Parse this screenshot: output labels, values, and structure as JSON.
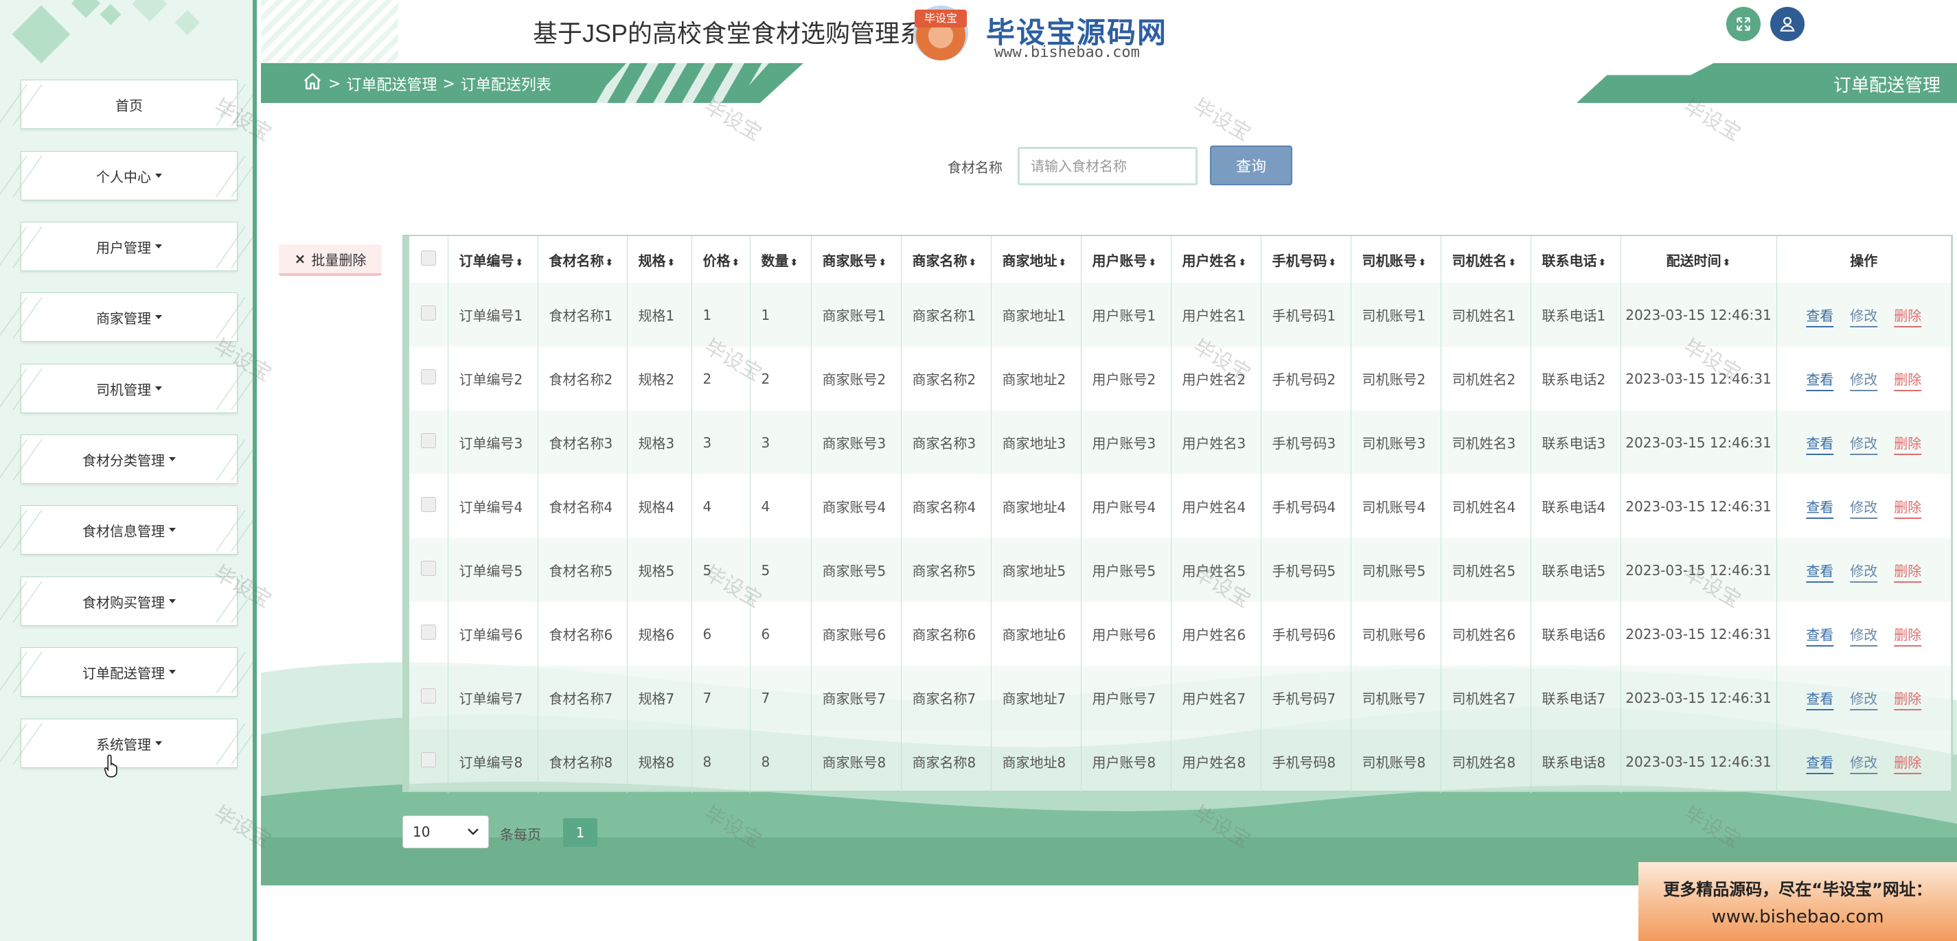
{
  "header": {
    "title": "基于JSP的高校食堂食材选购管理系统",
    "brand_badge": "毕设宝",
    "brand_name": "毕设宝源码网",
    "brand_url": "www.bishebao.com"
  },
  "breadcrumb": {
    "sep1": ">",
    "level1": "订单配送管理",
    "sep2": ">",
    "level2": "订单配送列表"
  },
  "page_title": "订单配送管理",
  "sidebar": {
    "items": [
      {
        "label": "首页"
      },
      {
        "label": "个人中心"
      },
      {
        "label": "用户管理"
      },
      {
        "label": "商家管理"
      },
      {
        "label": "司机管理"
      },
      {
        "label": "食材分类管理"
      },
      {
        "label": "食材信息管理"
      },
      {
        "label": "食材购买管理"
      },
      {
        "label": "订单配送管理"
      },
      {
        "label": "系统管理"
      }
    ]
  },
  "search": {
    "label": "食材名称",
    "placeholder": "请输入食材名称",
    "button": "查询"
  },
  "batch_delete": {
    "icon": "×",
    "label": "批量删除"
  },
  "table": {
    "headers": [
      "订单编号",
      "食材名称",
      "规格",
      "价格",
      "数量",
      "商家账号",
      "商家名称",
      "商家地址",
      "用户账号",
      "用户姓名",
      "手机号码",
      "司机账号",
      "司机姓名",
      "联系电话",
      "配送时间",
      "操作"
    ],
    "sort_icon": "⬍",
    "actions": {
      "view": "查看",
      "edit": "修改",
      "delete": "删除"
    },
    "rows": [
      [
        "订单编号1",
        "食材名称1",
        "规格1",
        "1",
        "1",
        "商家账号1",
        "商家名称1",
        "商家地址1",
        "用户账号1",
        "用户姓名1",
        "手机号码1",
        "司机账号1",
        "司机姓名1",
        "联系电话1",
        "2023-03-15 12:46:31"
      ],
      [
        "订单编号2",
        "食材名称2",
        "规格2",
        "2",
        "2",
        "商家账号2",
        "商家名称2",
        "商家地址2",
        "用户账号2",
        "用户姓名2",
        "手机号码2",
        "司机账号2",
        "司机姓名2",
        "联系电话2",
        "2023-03-15 12:46:31"
      ],
      [
        "订单编号3",
        "食材名称3",
        "规格3",
        "3",
        "3",
        "商家账号3",
        "商家名称3",
        "商家地址3",
        "用户账号3",
        "用户姓名3",
        "手机号码3",
        "司机账号3",
        "司机姓名3",
        "联系电话3",
        "2023-03-15 12:46:31"
      ],
      [
        "订单编号4",
        "食材名称4",
        "规格4",
        "4",
        "4",
        "商家账号4",
        "商家名称4",
        "商家地址4",
        "用户账号4",
        "用户姓名4",
        "手机号码4",
        "司机账号4",
        "司机姓名4",
        "联系电话4",
        "2023-03-15 12:46:31"
      ],
      [
        "订单编号5",
        "食材名称5",
        "规格5",
        "5",
        "5",
        "商家账号5",
        "商家名称5",
        "商家地址5",
        "用户账号5",
        "用户姓名5",
        "手机号码5",
        "司机账号5",
        "司机姓名5",
        "联系电话5",
        "2023-03-15 12:46:31"
      ],
      [
        "订单编号6",
        "食材名称6",
        "规格6",
        "6",
        "6",
        "商家账号6",
        "商家名称6",
        "商家地址6",
        "用户账号6",
        "用户姓名6",
        "手机号码6",
        "司机账号6",
        "司机姓名6",
        "联系电话6",
        "2023-03-15 12:46:31"
      ],
      [
        "订单编号7",
        "食材名称7",
        "规格7",
        "7",
        "7",
        "商家账号7",
        "商家名称7",
        "商家地址7",
        "用户账号7",
        "用户姓名7",
        "手机号码7",
        "司机账号7",
        "司机姓名7",
        "联系电话7",
        "2023-03-15 12:46:31"
      ],
      [
        "订单编号8",
        "食材名称8",
        "规格8",
        "8",
        "8",
        "商家账号8",
        "商家名称8",
        "商家地址8",
        "用户账号8",
        "用户姓名8",
        "手机号码8",
        "司机账号8",
        "司机姓名8",
        "联系电话8",
        "2023-03-15 12:46:31"
      ]
    ]
  },
  "pagination": {
    "page_size": "10",
    "page_size_label": "条每页",
    "current_page": "1"
  },
  "promo": {
    "line1": "更多精品源码，尽在“毕设宝”网址：",
    "line2": "www.bishebao.com"
  },
  "watermark_text": "毕设宝",
  "colors": {
    "primary": "#5aa886",
    "sidebar_bg": "#e9f6ef",
    "view_link": "#3b6ea8",
    "edit_link": "#6a88a8",
    "delete_link": "#e06d6d",
    "search_button": "#7a9cc0"
  },
  "icons": {
    "home": "home-icon",
    "fullscreen": "fullscreen-icon",
    "user": "user-icon",
    "close": "close-icon",
    "caret": "caret-down-icon"
  }
}
